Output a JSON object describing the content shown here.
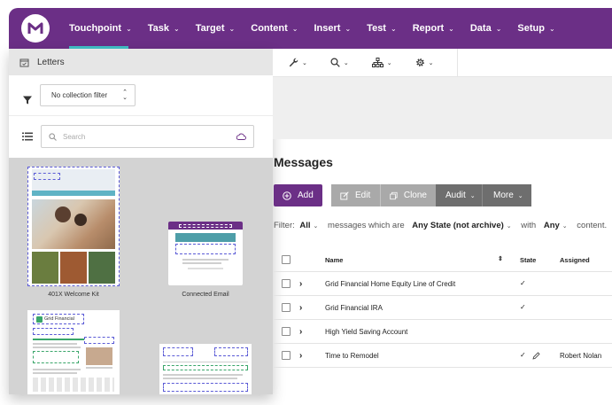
{
  "nav": {
    "items": [
      {
        "label": "Touchpoint",
        "active": true
      },
      {
        "label": "Task"
      },
      {
        "label": "Target"
      },
      {
        "label": "Content"
      },
      {
        "label": "Insert"
      },
      {
        "label": "Test"
      },
      {
        "label": "Report"
      },
      {
        "label": "Data"
      },
      {
        "label": "Setup"
      }
    ]
  },
  "left_panel": {
    "header": "Letters",
    "collection_filter": "No collection filter",
    "search_placeholder": "Search",
    "cards": [
      {
        "caption": "401X Welcome Kit"
      },
      {
        "caption": "Connected Email"
      },
      {
        "caption": "",
        "brand": "Grid Financial"
      }
    ]
  },
  "toolbar": {
    "icons": [
      "wrench-icon",
      "search-icon",
      "hierarchy-icon",
      "gear-icon"
    ]
  },
  "messages": {
    "title": "Messages",
    "buttons": {
      "add": "Add",
      "edit": "Edit",
      "clone": "Clone",
      "audit": "Audit",
      "more": "More"
    },
    "filter": {
      "prefix": "Filter:",
      "scope": "All",
      "mid": "messages which are",
      "state": "Any State (not archive)",
      "with": "with",
      "content": "Any",
      "suffix": "content."
    },
    "columns": {
      "name": "Name",
      "state": "State",
      "assigned": "Assigned"
    },
    "rows": [
      {
        "name": "Grid Financial Home Equity Line of Credit",
        "state": "✓",
        "assigned": ""
      },
      {
        "name": "Grid Financial IRA",
        "state": "✓",
        "assigned": ""
      },
      {
        "name": "High Yield Saving Account",
        "state": "",
        "assigned": ""
      },
      {
        "name": "Time to Remodel",
        "state": "✓",
        "assigned": "Robert Nolan"
      }
    ]
  },
  "colors": {
    "brand": "#6b2f86",
    "accent": "#41c0c6"
  }
}
